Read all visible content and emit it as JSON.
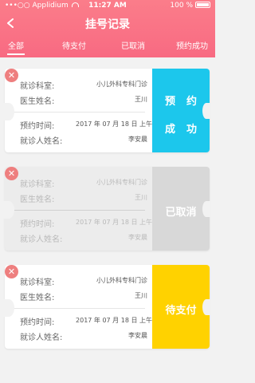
{
  "status_bar": {
    "carrier": "•••○○ Applidium",
    "time": "11:27 AM",
    "battery": "100 %"
  },
  "header": {
    "title": "挂号记录"
  },
  "tabs": [
    {
      "label": "全部",
      "active": true
    },
    {
      "label": "待支付",
      "active": false
    },
    {
      "label": "已取消",
      "active": false
    },
    {
      "label": "预约成功",
      "active": false
    }
  ],
  "labels": {
    "department": "就诊科室:",
    "doctor": "医生姓名:",
    "time": "预约时间:",
    "patient": "就诊人姓名:"
  },
  "records": [
    {
      "department": "小儿外科专科门诊",
      "doctor": "王川",
      "time": "2017 年 07 月 18 日 上午",
      "patient": "李安晨",
      "status_lines": [
        "预约",
        "成功"
      ],
      "status_color": "#1cc7ec",
      "dimmed": false
    },
    {
      "department": "小儿外科专科门诊",
      "doctor": "王川",
      "time": "2017 年 07 月 18 日 上午",
      "patient": "李安晨",
      "status_lines": [
        "已取消"
      ],
      "status_color": "#d8d8d8",
      "dimmed": true
    },
    {
      "department": "小儿外科专科门诊",
      "doctor": "王川",
      "time": "2017 年 07 月 18 日 上午",
      "patient": "李安晨",
      "status_lines": [
        "待支付"
      ],
      "status_color": "#ffd200",
      "dimmed": false
    }
  ]
}
